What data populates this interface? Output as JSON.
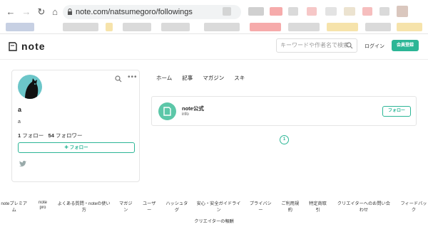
{
  "browser": {
    "url": "note.com/natsumegoro/followings"
  },
  "header": {
    "logo_text": "note",
    "search_placeholder": "キーワードや作者名で検索",
    "login_label": "ログイン",
    "publish_label": "会員登録"
  },
  "profile": {
    "name": "a",
    "description": "a",
    "following_count": "1",
    "following_label": "フォロー",
    "followers_count": "54",
    "followers_label": "フォロワー",
    "follow_button_label": "フォロー"
  },
  "tabs": [
    "ホーム",
    "記事",
    "マガジン",
    "スキ"
  ],
  "following_item": {
    "title": "note公式",
    "subtitle": "info",
    "follow_label": "フォロー"
  },
  "pagination": {
    "current_page": "1"
  },
  "footer": {
    "links_row1": [
      "noteプレミアム",
      "note pro",
      "よくある質問・noteの使い方",
      "マガジン",
      "ユーザー",
      "ハッシュタグ",
      "安心・安全ガイドライン",
      "プライバシー",
      "ご利用規約",
      "特定商取引",
      "クリエイターへのお問い合わせ",
      "フィードバック"
    ],
    "links_row2": [
      "クリエイターの報酬"
    ]
  },
  "colors": {
    "accent": "#2cb696",
    "avatar_bg": "#6cc6c9",
    "item_icon_bg": "#5cc7a8"
  }
}
